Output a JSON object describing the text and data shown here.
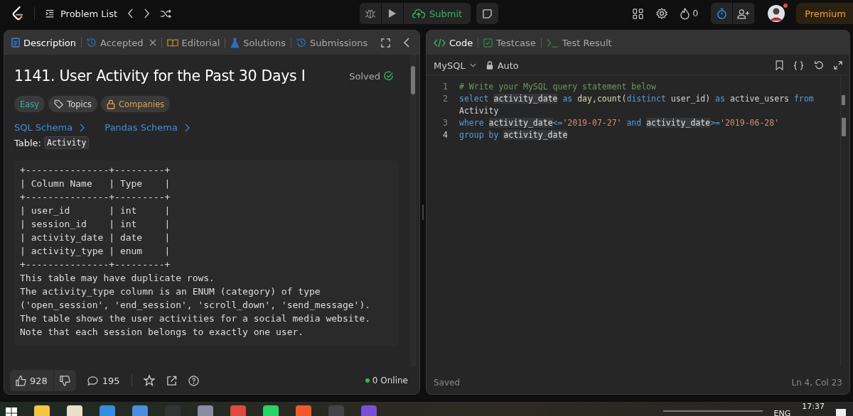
{
  "top_bar": {
    "problem_list": "Problem List",
    "submit": "Submit",
    "streak": "0",
    "premium": "Premium",
    "notification_dot": true
  },
  "left_panel": {
    "tabs": [
      {
        "label": "Description",
        "selected": true,
        "closable": false
      },
      {
        "label": "Accepted",
        "selected": false,
        "closable": true
      },
      {
        "label": "Editorial",
        "selected": false,
        "closable": false
      },
      {
        "label": "Solutions",
        "selected": false,
        "closable": false
      },
      {
        "label": "Submissions",
        "selected": false,
        "closable": false
      }
    ],
    "title": "1141. User Activity for the Past 30 Days I",
    "status": "Solved",
    "tags": [
      {
        "label": "Easy",
        "kind": "difficulty"
      },
      {
        "label": "Topics",
        "kind": "tag"
      },
      {
        "label": "Companies",
        "kind": "locked"
      }
    ],
    "links": [
      "SQL Schema",
      "Pandas Schema"
    ],
    "table_label": "Table:",
    "table_name": "Activity",
    "schema_table": [
      "+---------------+---------+",
      "| Column Name   | Type    |",
      "+---------------+---------+",
      "| user_id       | int     |",
      "| session_id    | int     |",
      "| activity_date | date    |",
      "| activity_type | enum    |",
      "+---------------+---------+"
    ],
    "table_notes": [
      "This table may have duplicate rows.",
      "The activity_type column is an ENUM (category) of type",
      "('open_session', 'end_session', 'scroll_down', 'send_message').",
      "The table shows the user activities for a social media website.",
      "Note that each session belongs to exactly one user."
    ],
    "footer": {
      "likes": "928",
      "comments": "195",
      "online": "0 Online"
    }
  },
  "right_panel": {
    "tabs": [
      {
        "label": "Code",
        "selected": true
      },
      {
        "label": "Testcase",
        "selected": false
      },
      {
        "label": "Test Result",
        "selected": false
      }
    ],
    "language": "MySQL",
    "mode": "Auto",
    "code_lines": [
      {
        "number": "1",
        "active": false,
        "tokens": [
          {
            "kind": "comment",
            "text": "# Write your MySQL query statement below"
          }
        ]
      },
      {
        "number": "2",
        "active": false,
        "tokens": [
          {
            "kind": "kw",
            "text": "select "
          },
          {
            "kind": "match",
            "text": "activity_date"
          },
          {
            "kind": "kw",
            "text": " as "
          },
          {
            "kind": "fn",
            "text": "day"
          },
          {
            "kind": "plain",
            "text": ","
          },
          {
            "kind": "fn",
            "text": "count"
          },
          {
            "kind": "plain",
            "text": "("
          },
          {
            "kind": "kw",
            "text": "distinct"
          },
          {
            "kind": "plain",
            "text": " user_id) "
          },
          {
            "kind": "kw",
            "text": "as"
          },
          {
            "kind": "plain",
            "text": " active_users "
          },
          {
            "kind": "kw",
            "text": "from"
          }
        ],
        "wrap_tokens": [
          {
            "kind": "plain",
            "text": "Activity"
          }
        ]
      },
      {
        "number": "3",
        "active": false,
        "tokens": [
          {
            "kind": "kw",
            "text": "where "
          },
          {
            "kind": "match",
            "text": "activity_date"
          },
          {
            "kind": "kw",
            "text": "<="
          },
          {
            "kind": "str",
            "text": "'2019-07-27'"
          },
          {
            "kind": "kw",
            "text": " and "
          },
          {
            "kind": "match",
            "text": "activity_date"
          },
          {
            "kind": "kw",
            "text": ">="
          },
          {
            "kind": "str",
            "text": "'2019-06-28'"
          }
        ]
      },
      {
        "number": "4",
        "active": true,
        "tokens": [
          {
            "kind": "kw",
            "text": "group by "
          },
          {
            "kind": "match",
            "text": "activity_date"
          }
        ]
      }
    ],
    "saved": "Saved",
    "cursor": "Ln 4, Col 23"
  },
  "taskbar": {
    "language": "ENG",
    "time": "17:37"
  }
}
